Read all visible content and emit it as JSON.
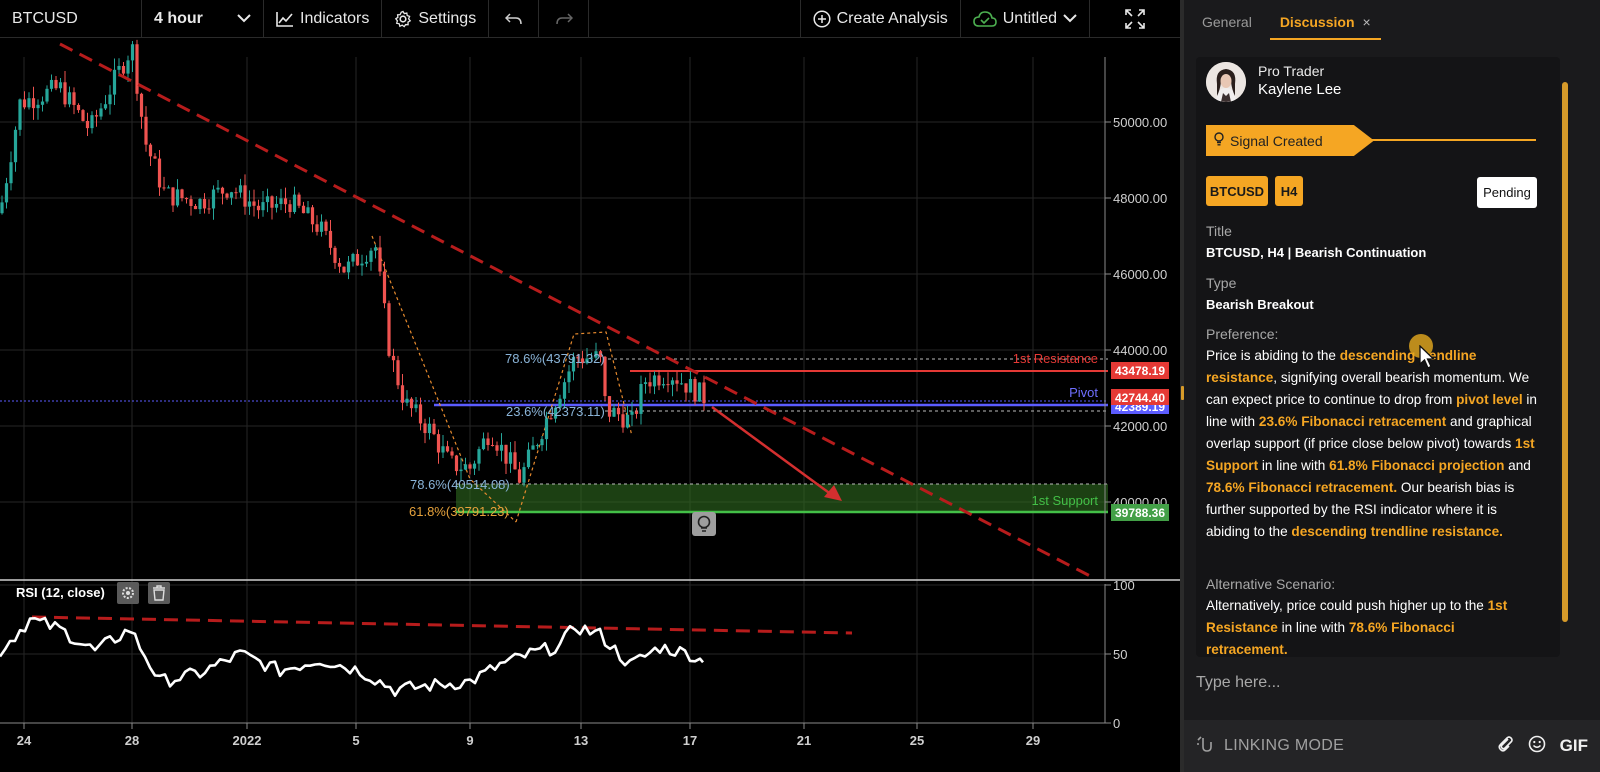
{
  "toolbar": {
    "symbol": "BTCUSD",
    "interval": "4 hour",
    "indicators_label": "Indicators",
    "settings_label": "Settings",
    "create_analysis_label": "Create Analysis",
    "save_status_label": "Untitled"
  },
  "chart_data": {
    "type": "candlestick",
    "y_ticks": [
      "50000.00",
      "48000.00",
      "46000.00",
      "44000.00",
      "42000.00",
      "40000.00"
    ],
    "y_tick_values": [
      50000,
      48000,
      46000,
      44000,
      42000,
      40000
    ],
    "x_ticks": [
      "24",
      "28",
      "2022",
      "5",
      "9",
      "13",
      "17",
      "21",
      "25",
      "29"
    ],
    "price_tags": {
      "resistance": "43478.19",
      "current": "42744.40",
      "below_current": "42389.19",
      "support": "39788.36"
    },
    "levels": {
      "resistance_label": "1st Resistance",
      "pivot_label": "Pivot",
      "support_label": "1st Support"
    },
    "fibonacci": {
      "fib_786_upper": "78.6%(43791.32)",
      "fib_236": "23.6%(42373.11)",
      "fib_786_lower": "78.6%(40514.08)",
      "fib_618": "61.8%(39791.23)"
    },
    "rsi": {
      "label": "RSI (12, close)",
      "y_ticks": [
        "100",
        "50",
        "0"
      ]
    },
    "colors": {
      "bull": "#26a69a",
      "bear": "#ef5350",
      "resistance": "#e53935",
      "pivot": "#5c5cff",
      "support": "#43a047",
      "trendline": "#b71c1c",
      "fib_label": "#8ab4d8",
      "fib_618_label": "#e6a23c"
    }
  },
  "panel": {
    "tabs": [
      {
        "label": "General",
        "active": false
      },
      {
        "label": "Discussion",
        "active": true,
        "close": "×"
      }
    ],
    "author": {
      "role": "Pro Trader",
      "name": "Kaylene Lee"
    },
    "signal_banner": "Signal Created",
    "symbol_chip": "BTCUSD",
    "timeframe_chip": "H4",
    "status": "Pending",
    "title_label": "Title",
    "title_value": "BTCUSD, H4 | Bearish Continuation",
    "type_label": "Type",
    "type_value": "Bearish Breakout",
    "preference_label": "Preference:",
    "preference": {
      "t1": "Price is abiding to the ",
      "h1": "descending trendline resistance",
      "t2": ", signifying overall bearish momentum. We can expect price to continue to drop from ",
      "h2": "pivot level",
      "t3": " in line with ",
      "h3": "23.6% Fibonacci retracement",
      "t4": " and graphical overlap support (if price close below pivot) towards ",
      "h4": "1st Support",
      "t5": " in line with ",
      "h5": "61.8% Fibonacci projection",
      "t6": " and ",
      "h6": "78.6% Fibonacci retracement.",
      "t7": " Our bearish bias is further supported by the RSI indicator where it is abiding to the ",
      "h7": "descending trendline resistance."
    },
    "alt_label": "Alternative Scenario:",
    "alternative": {
      "t1": "Alternatively, price could push higher up to the ",
      "h1": "1st Resistance",
      "t2": " in line with ",
      "h2": "78.6% Fibonacci retracement."
    },
    "composer_placeholder": "Type here...",
    "linking_mode": "LINKING MODE",
    "gif_label": "GIF"
  }
}
